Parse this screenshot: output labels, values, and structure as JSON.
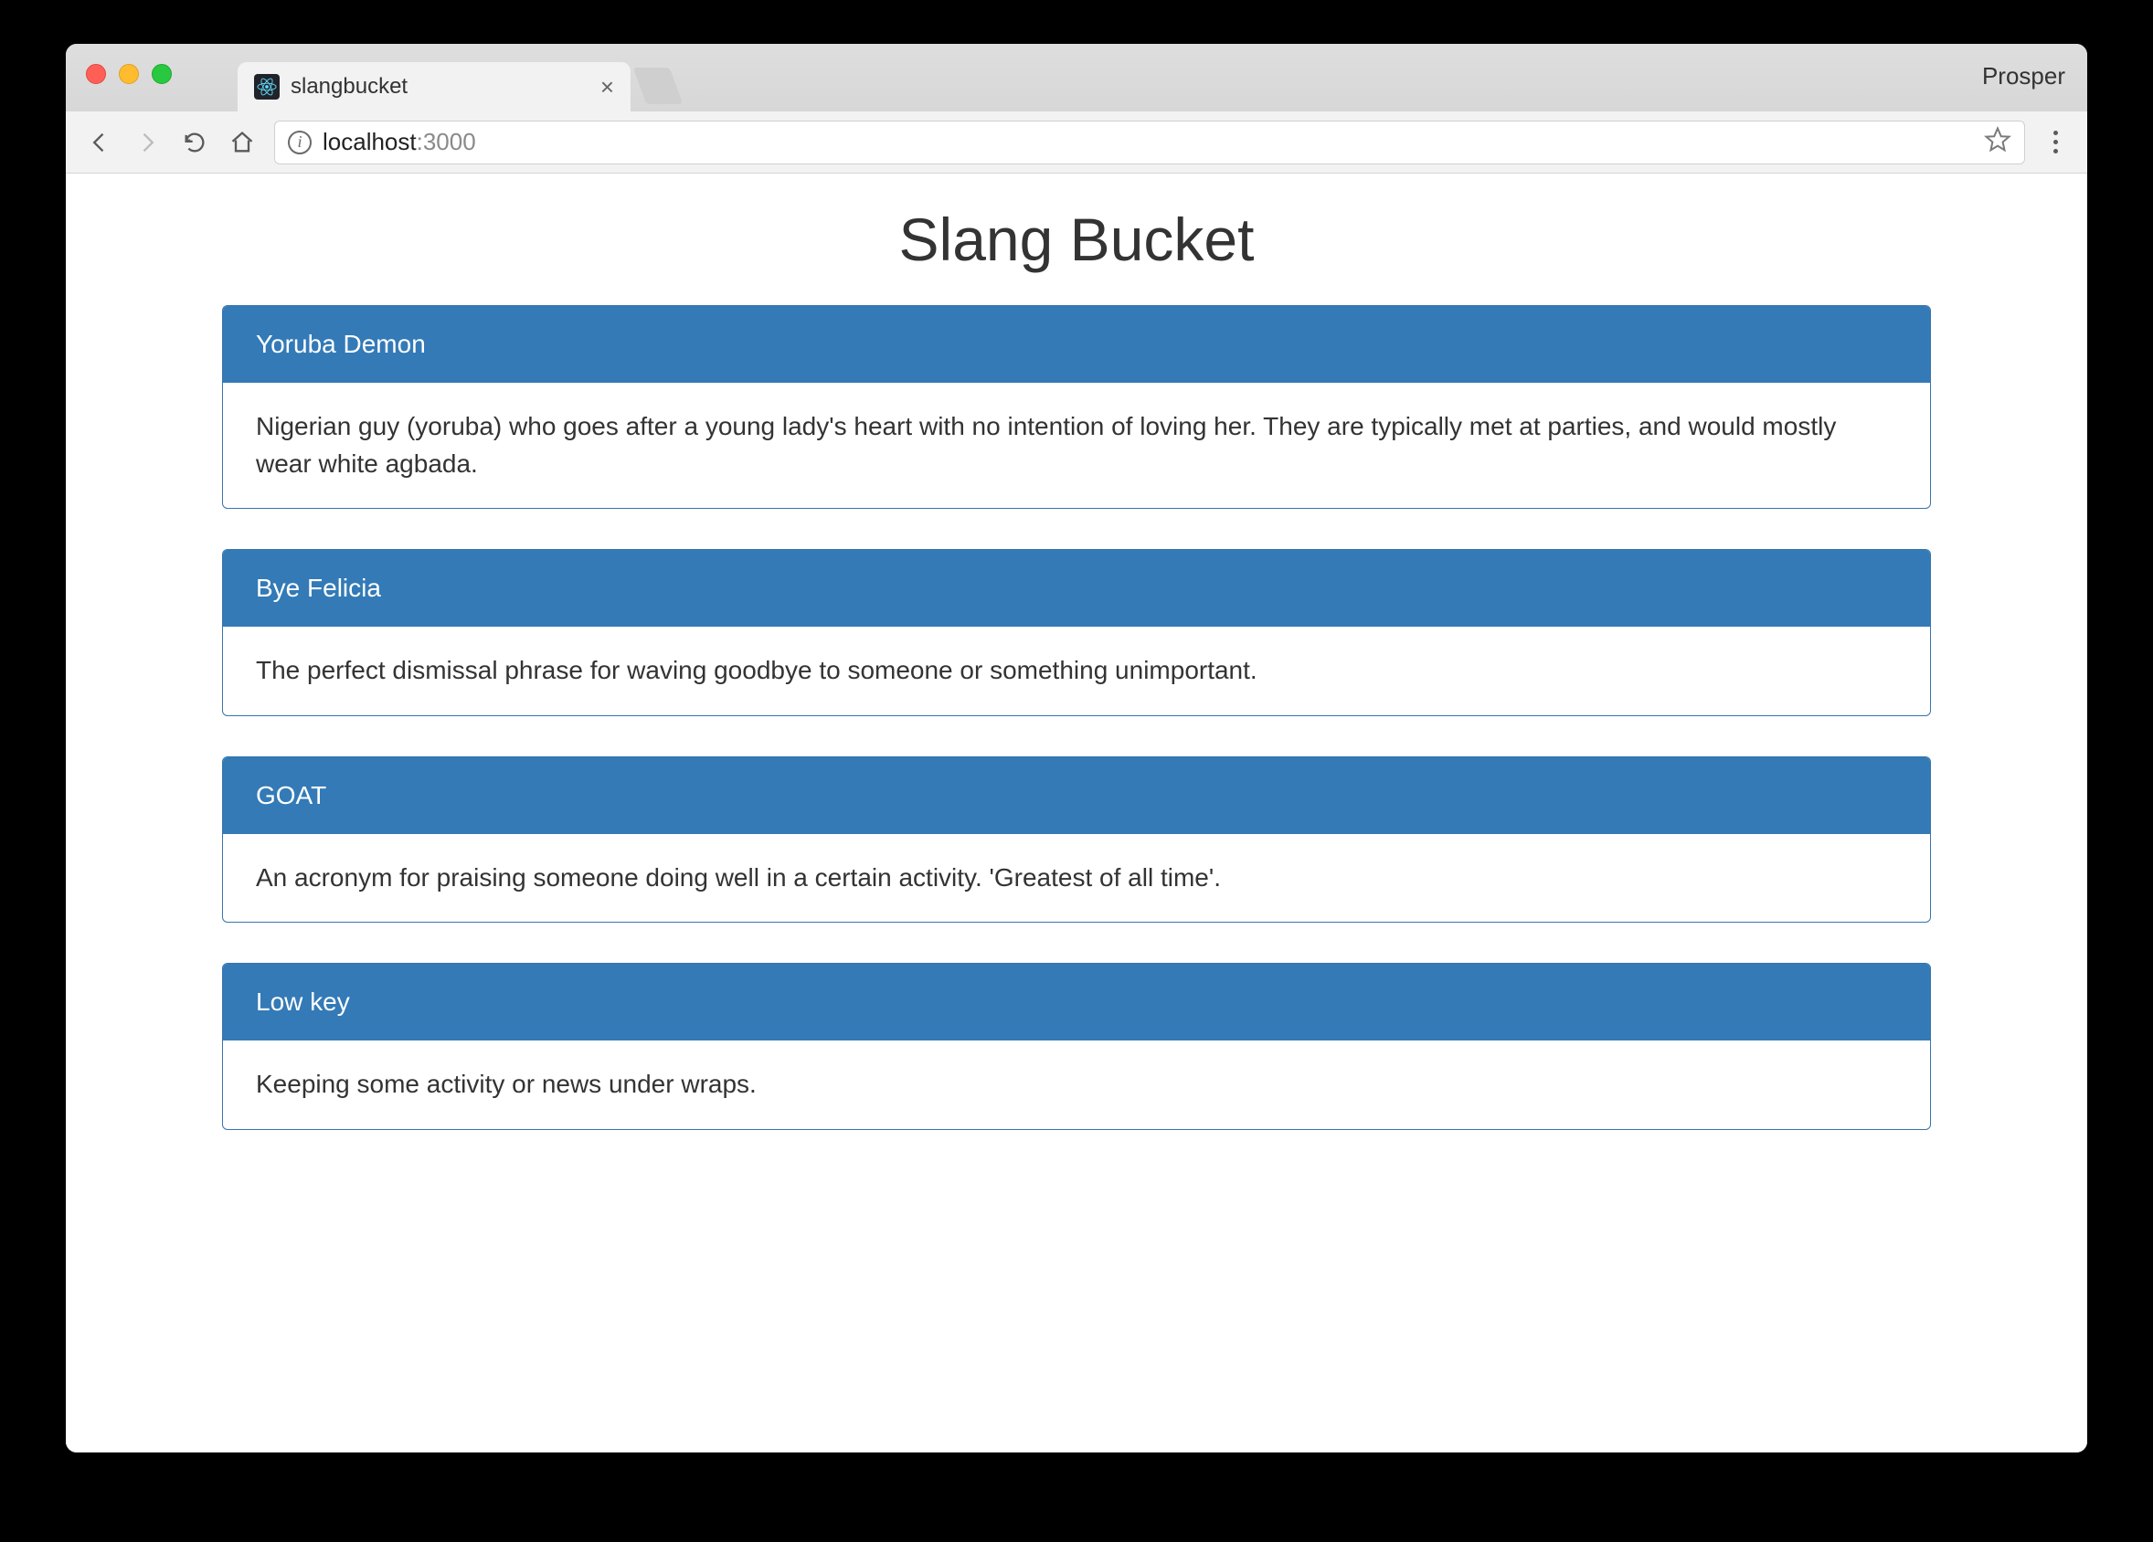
{
  "browser": {
    "tab_title": "slangbucket",
    "profile_name": "Prosper",
    "url_host": "localhost",
    "url_port": ":3000"
  },
  "page": {
    "title": "Slang Bucket"
  },
  "slangs": [
    {
      "term": "Yoruba Demon",
      "definition": "Nigerian guy (yoruba) who goes after a young lady's heart with no intention of loving her. They are typically met at parties, and would mostly wear white agbada."
    },
    {
      "term": "Bye Felicia",
      "definition": "The perfect dismissal phrase for waving goodbye to someone or something unimportant."
    },
    {
      "term": "GOAT",
      "definition": "An acronym for praising someone doing well in a certain activity. 'Greatest of all time'."
    },
    {
      "term": "Low key",
      "definition": "Keeping some activity or news under wraps."
    }
  ]
}
